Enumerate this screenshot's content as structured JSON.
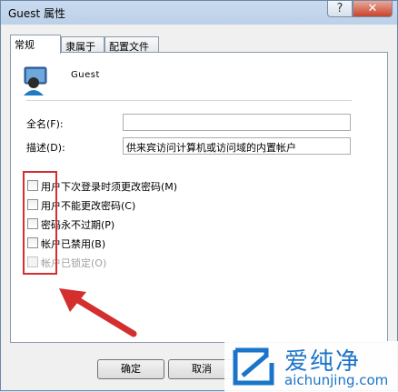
{
  "window": {
    "title": "Guest 属性",
    "help_label": "?",
    "close_label": "✕"
  },
  "tabs": [
    {
      "label": "常规"
    },
    {
      "label": "隶属于"
    },
    {
      "label": "配置文件"
    }
  ],
  "user": {
    "name": "Guest"
  },
  "fields": {
    "fullname_label": "全名(F):",
    "fullname_value": "",
    "description_label": "描述(D):",
    "description_value": "供来宾访问计算机或访问域的内置帐户"
  },
  "options": [
    {
      "label": "用户下次登录时须更改密码(M)",
      "checked": false,
      "disabled": false
    },
    {
      "label": "用户不能更改密码(C)",
      "checked": false,
      "disabled": false
    },
    {
      "label": "密码永不过期(P)",
      "checked": false,
      "disabled": false
    },
    {
      "label": "帐户已禁用(B)",
      "checked": false,
      "disabled": false
    },
    {
      "label": "帐户已锁定(O)",
      "checked": false,
      "disabled": true
    }
  ],
  "buttons": {
    "ok": "确定",
    "cancel": "取消"
  },
  "watermark": {
    "cn": "爱纯净",
    "en": "aichunjing.com"
  },
  "colors": {
    "highlight": "#d32f2f",
    "watermark": "#1a74c9"
  }
}
